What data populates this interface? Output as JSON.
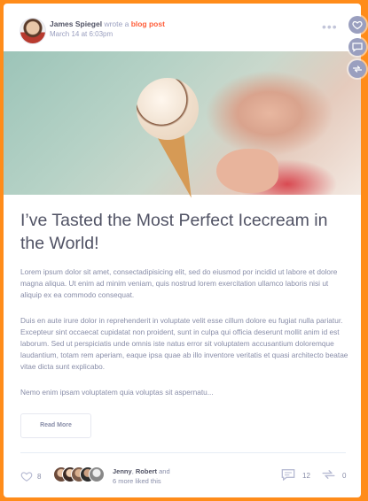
{
  "post": {
    "author_name": "James Spiegel",
    "action_text": "wrote a",
    "post_type_link": "blog post",
    "date": "March 14 at 6:03pm",
    "title": "I’ve Tasted the Most Perfect Icecream in the World!",
    "paragraph_1": "Lorem ipsum dolor sit amet, consectadipisicing elit, sed do eiusmod por incidid ut labore et dolore magna aliqua. Ut enim ad minim veniam, quis nostrud lorem exercitation ullamco laboris nisi ut aliquip ex ea commodo consequat.",
    "paragraph_2": "Duis en aute irure dolor in reprehenderit in voluptate velit esse cillum dolore eu fugiat nulla pariatur. Excepteur sint occaecat cupidatat non proident, sunt in culpa qui officia deserunt mollit anim id est laborum. Sed ut perspiciatis unde omnis iste natus error sit voluptatem accusantium doloremque laudantium, totam rem aperiam, eaque ipsa quae ab illo inventore veritatis et quasi architecto beatae vitae dicta sunt explicabo.",
    "paragraph_3": "Nemo enim ipsam voluptatem quia voluptas sit aspernatu...",
    "read_more_label": "Read More"
  },
  "footer": {
    "like_count": "8",
    "liked_by_1": "Jenny",
    "liked_by_sep": ",",
    "liked_by_2": "Robert",
    "liked_by_and": "and",
    "liked_more": "6 more liked this",
    "comment_count": "12",
    "share_count": "0"
  },
  "icons": {
    "more": "more-dots-icon",
    "like": "heart-icon",
    "comment": "comment-icon",
    "share": "share-icon"
  },
  "colors": {
    "accent": "#ff5e3a",
    "frame": "#ff8c1a",
    "side_buttons": "#9a9fbf"
  }
}
